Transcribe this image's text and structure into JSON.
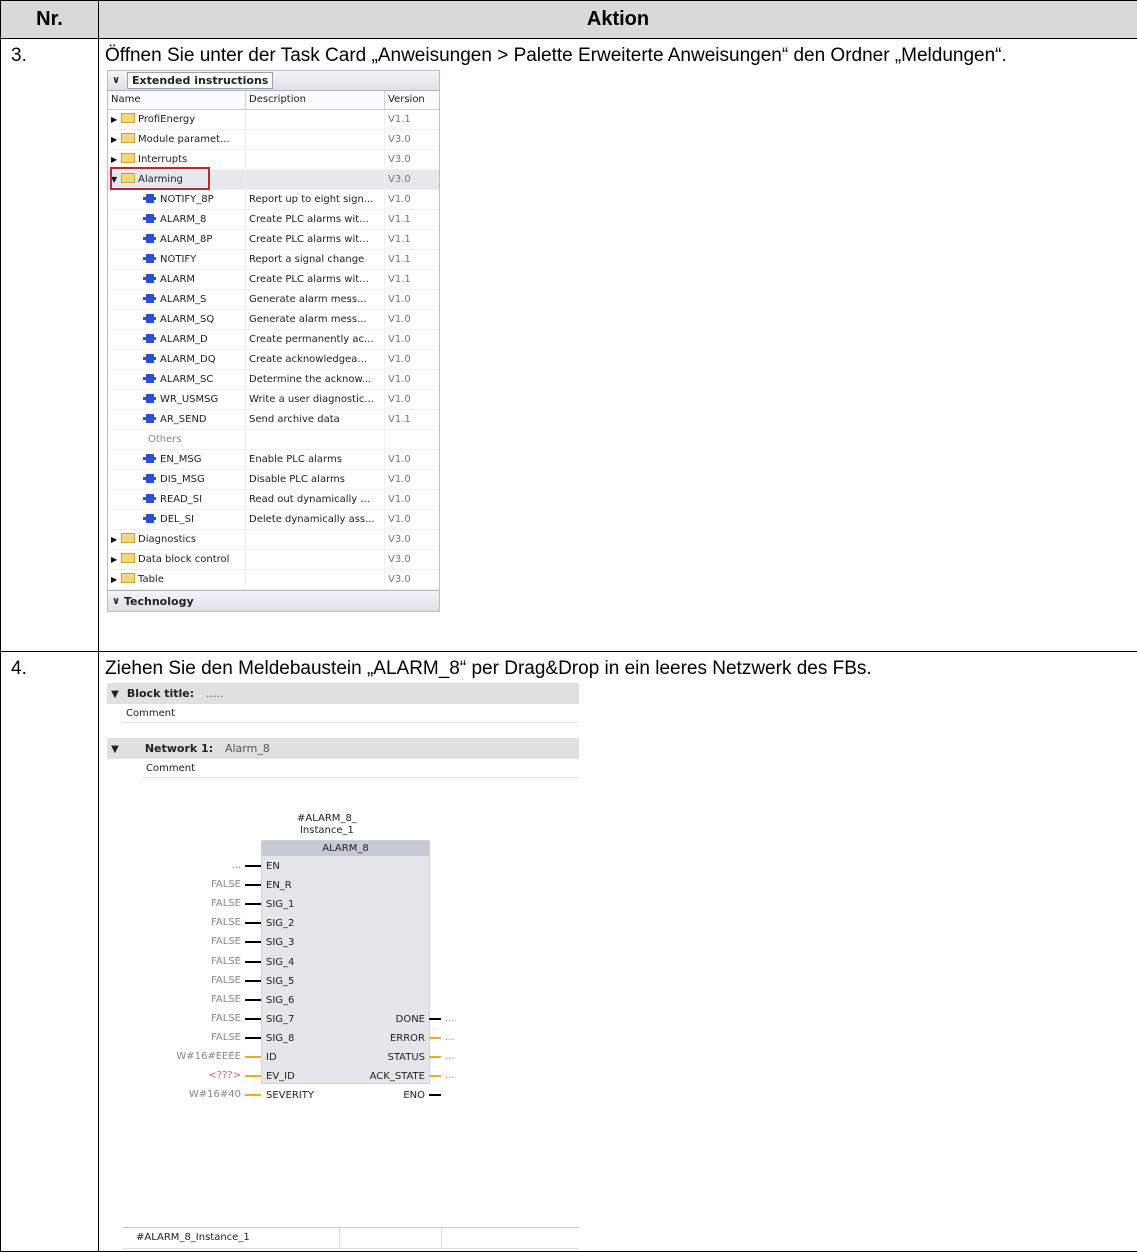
{
  "table": {
    "col_nr": "Nr.",
    "col_action": "Aktion"
  },
  "step3": {
    "nr": "3.",
    "text": "Öffnen Sie unter der Task Card „Anweisungen > Palette Erweiterte Anweisungen“ den Ordner „Meldungen“."
  },
  "extended_instructions": {
    "title": "Extended instructions",
    "columns": {
      "name": "Name",
      "description": "Description",
      "version": "Version"
    },
    "folders_top": [
      {
        "name": "ProfiEnergy",
        "version": "V1.1"
      },
      {
        "name": "Module paramet...",
        "version": "V3.0"
      },
      {
        "name": "Interrupts",
        "version": "V3.0"
      }
    ],
    "alarming": {
      "name": "Alarming",
      "version": "V3.0"
    },
    "items": [
      {
        "name": "NOTIFY_8P",
        "description": "Report up to eight sign...",
        "version": "V1.0"
      },
      {
        "name": "ALARM_8",
        "description": "Create PLC alarms wit...",
        "version": "V1.1"
      },
      {
        "name": "ALARM_8P",
        "description": "Create PLC alarms wit...",
        "version": "V1.1"
      },
      {
        "name": "NOTIFY",
        "description": "Report a signal change",
        "version": "V1.1"
      },
      {
        "name": "ALARM",
        "description": "Create PLC alarms wit...",
        "version": "V1.1"
      },
      {
        "name": "ALARM_S",
        "description": "Generate alarm mess...",
        "version": "V1.0"
      },
      {
        "name": "ALARM_SQ",
        "description": "Generate alarm mess...",
        "version": "V1.0"
      },
      {
        "name": "ALARM_D",
        "description": "Create permanently ac...",
        "version": "V1.0"
      },
      {
        "name": "ALARM_DQ",
        "description": "Create acknowledgea...",
        "version": "V1.0"
      },
      {
        "name": "ALARM_SC",
        "description": "Determine the acknow...",
        "version": "V1.0"
      },
      {
        "name": "WR_USMSG",
        "description": "Write a user diagnostic...",
        "version": "V1.0"
      },
      {
        "name": "AR_SEND",
        "description": "Send archive data",
        "version": "V1.1"
      }
    ],
    "others_label": "Others",
    "others_items": [
      {
        "name": "EN_MSG",
        "description": "Enable PLC alarms",
        "version": "V1.0"
      },
      {
        "name": "DIS_MSG",
        "description": "Disable PLC alarms",
        "version": "V1.0"
      },
      {
        "name": "READ_SI",
        "description": "Read out dynamically ...",
        "version": "V1.0"
      },
      {
        "name": "DEL_SI",
        "description": "Delete dynamically ass...",
        "version": "V1.0"
      }
    ],
    "folders_bottom": [
      {
        "name": "Diagnostics",
        "version": "V3.0"
      },
      {
        "name": "Data block control",
        "version": "V3.0"
      },
      {
        "name": "Table",
        "version": "V3.0"
      }
    ],
    "technology": "Technology"
  },
  "step4": {
    "nr": "4.",
    "text": "Ziehen Sie den Meldebaustein „ALARM_8“ per Drag&Drop in ein leeres Netzwerk des FBs."
  },
  "network": {
    "block_title": "Block title:",
    "block_title_dots": ".....",
    "comment1": "Comment",
    "network_label": "Network 1:",
    "network_name": "Alarm_8",
    "comment2": "Comment",
    "instance_line1": "#ALARM_8_",
    "instance_line2": "Instance_1",
    "block_name": "ALARM_8",
    "inputs": [
      {
        "pin": "EN",
        "value": "..."
      },
      {
        "pin": "EN_R",
        "value": "FALSE"
      },
      {
        "pin": "SIG_1",
        "value": "FALSE"
      },
      {
        "pin": "SIG_2",
        "value": "FALSE"
      },
      {
        "pin": "SIG_3",
        "value": "FALSE"
      },
      {
        "pin": "SIG_4",
        "value": "FALSE"
      },
      {
        "pin": "SIG_5",
        "value": "FALSE"
      },
      {
        "pin": "SIG_6",
        "value": "FALSE"
      },
      {
        "pin": "SIG_7",
        "value": "FALSE"
      },
      {
        "pin": "SIG_8",
        "value": "FALSE"
      },
      {
        "pin": "ID",
        "value": "W#16#EEEE"
      },
      {
        "pin": "EV_ID",
        "value": "<???>"
      },
      {
        "pin": "SEVERITY",
        "value": "W#16#40"
      }
    ],
    "outputs": [
      {
        "pin": "DONE",
        "value": "..."
      },
      {
        "pin": "ERROR",
        "value": "..."
      },
      {
        "pin": "STATUS",
        "value": "..."
      },
      {
        "pin": "ACK_STATE",
        "value": "..."
      },
      {
        "pin": "ENO",
        "value": ""
      }
    ],
    "bottom_instance": "#ALARM_8_Instance_1"
  }
}
